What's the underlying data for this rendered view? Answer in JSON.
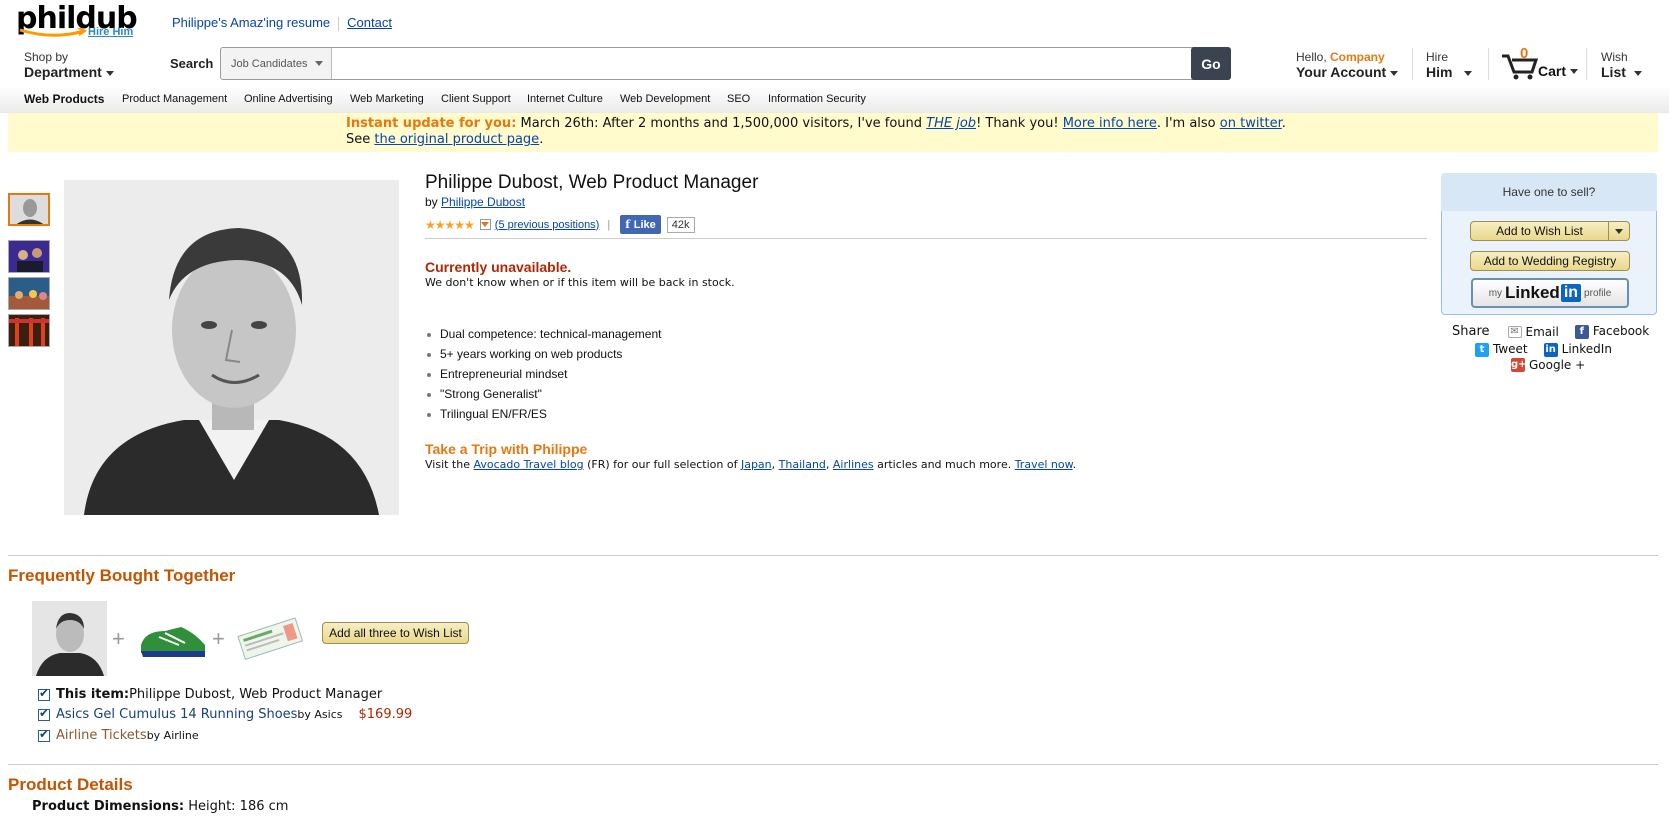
{
  "header": {
    "logo_word": "phildub",
    "logo_tag": "Hire Him",
    "top_links": [
      "Philippe's Amaz'ing resume",
      "Contact"
    ],
    "shop_by": {
      "line1": "Shop by",
      "line2": "Department"
    },
    "search": {
      "label": "Search",
      "category": "Job Candidates",
      "value": "",
      "go_label": "Go"
    },
    "account": {
      "hello": "Hello, ",
      "company": "Company",
      "line2": "Your Account"
    },
    "hire": {
      "line1": "Hire",
      "line2": "Him"
    },
    "cart": {
      "count": "0",
      "label": "Cart"
    },
    "wish": {
      "line1": "Wish",
      "line2": "List"
    }
  },
  "nav": [
    "Web Products",
    "Product Management",
    "Online Advertising",
    "Web Marketing",
    "Client Support",
    "Internet Culture",
    "Web Development",
    "SEO",
    "Information Security"
  ],
  "banner": {
    "highlight": "Instant update for you:",
    "text1": " March 26th: After 2 months and 1,500,000 visitors, I've found ",
    "the": "THE",
    "job": " job",
    "text2": "! Thank you! ",
    "more": "More info here",
    "text3": ". I'm also ",
    "twitter": "on twitter",
    "text4": ".",
    "see": "See ",
    "original": "the original product page",
    "end": "."
  },
  "product": {
    "title": "Philippe Dubost, Web Product Manager",
    "by": "by ",
    "author": "Philippe Dubost",
    "stars": "★★★★★",
    "positions": "(5 previous positions)",
    "like_label": "Like",
    "like_count": "42k",
    "unavailable": "Currently unavailable.",
    "unavailable_note": "We don't know when or if this item will be back in stock.",
    "bullets": [
      "Dual competence: technical-management",
      "5+ years working on web products",
      "Entrepreneurial mindset",
      "\"Strong Generalist\"",
      "Trilingual EN/FR/ES"
    ],
    "trip_title": "Take a Trip with Philippe",
    "trip": {
      "t1": "Visit the ",
      "blog": "Avocado Travel blog",
      "t2": " (FR) for our full selection of ",
      "japan": "Japan",
      "c1": ", ",
      "thailand": "Thailand",
      "c2": ", ",
      "airlines": "Airlines",
      "t3": " articles and much more. ",
      "travel": "Travel now",
      "end": "."
    }
  },
  "sidebar": {
    "sell_title": "Have one to sell?",
    "wishlist": "Add to Wish List",
    "wedding": "Add to Wedding Registry",
    "linkedin": {
      "my": "my",
      "linked": "Linked",
      "in": "in",
      "profile": "profile"
    },
    "share_label": "Share",
    "share": {
      "email": "Email",
      "facebook": "Facebook",
      "tweet": "Tweet",
      "linkedin": "LinkedIn",
      "google": "Google +"
    }
  },
  "fbt": {
    "title": "Frequently Bought Together",
    "button": "Add all three to Wish List",
    "items": [
      {
        "prefix": "This item:",
        "name": " Philippe Dubost, Web Product Manager",
        "by": "",
        "price": ""
      },
      {
        "prefix": "",
        "name": "Asics Gel Cumulus 14 Running Shoes",
        "by": " by Asics",
        "price": "$169.99"
      },
      {
        "prefix": "",
        "name": "Airline Tickets",
        "by": " by Airline",
        "price": ""
      }
    ]
  },
  "details": {
    "title": "Product Details",
    "dim_label": "Product Dimensions:",
    "dim_value": " Height: 186 cm"
  },
  "colors": {
    "accent": "#e47911",
    "section": "#c45500",
    "price": "#b12704",
    "link": "#0645ad"
  }
}
